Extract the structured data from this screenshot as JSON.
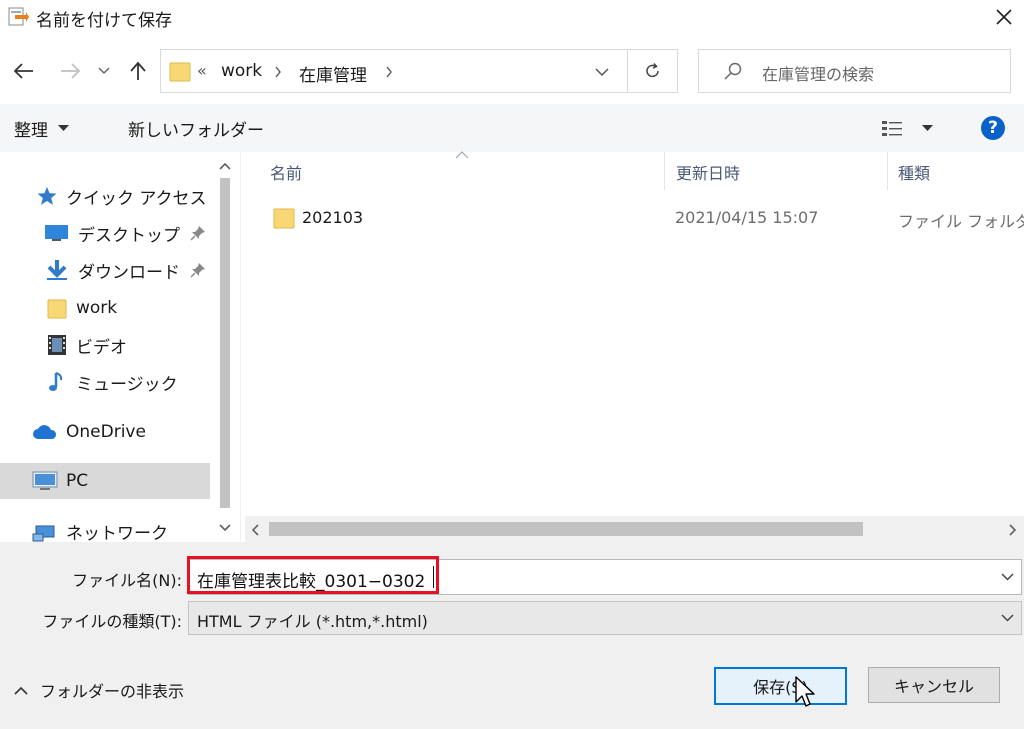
{
  "window": {
    "title": "名前を付けて保存"
  },
  "address": {
    "overflow": "«",
    "crumbs": [
      "work",
      "在庫管理"
    ],
    "search_placeholder": "在庫管理の検索"
  },
  "toolbar": {
    "organize": "整理",
    "new_folder": "新しいフォルダー"
  },
  "sidebar": {
    "items": [
      {
        "label": "クイック アクセス",
        "icon": "star-icon"
      },
      {
        "label": "デスクトップ",
        "icon": "desktop-icon",
        "pinned": true
      },
      {
        "label": "ダウンロード",
        "icon": "download-icon",
        "pinned": true
      },
      {
        "label": "work",
        "icon": "folder-icon"
      },
      {
        "label": "ビデオ",
        "icon": "video-icon"
      },
      {
        "label": "ミュージック",
        "icon": "music-icon"
      },
      {
        "label": "OneDrive",
        "icon": "cloud-icon"
      },
      {
        "label": "PC",
        "icon": "pc-icon",
        "selected": true
      },
      {
        "label": "ネットワーク",
        "icon": "network-icon"
      }
    ]
  },
  "file_list": {
    "columns": [
      "名前",
      "更新日時",
      "種類"
    ],
    "rows": [
      {
        "name": "202103",
        "modified": "2021/04/15 15:07",
        "type": "ファイル フォルダー"
      }
    ]
  },
  "form": {
    "filename_label": "ファイル名(N):",
    "filename_value": "在庫管理表比較_0301−0302",
    "filetype_label": "ファイルの種類(T):",
    "filetype_value": "HTML ファイル (*.htm,*.html)"
  },
  "footer": {
    "hide_folders": "フォルダーの非表示",
    "save": "保存(S)",
    "cancel": "キャンセル"
  },
  "colors": {
    "accent": "#0078d7",
    "highlight": "#e81123",
    "folder": "#f8d775",
    "selected_bg": "#d9d9d9"
  }
}
